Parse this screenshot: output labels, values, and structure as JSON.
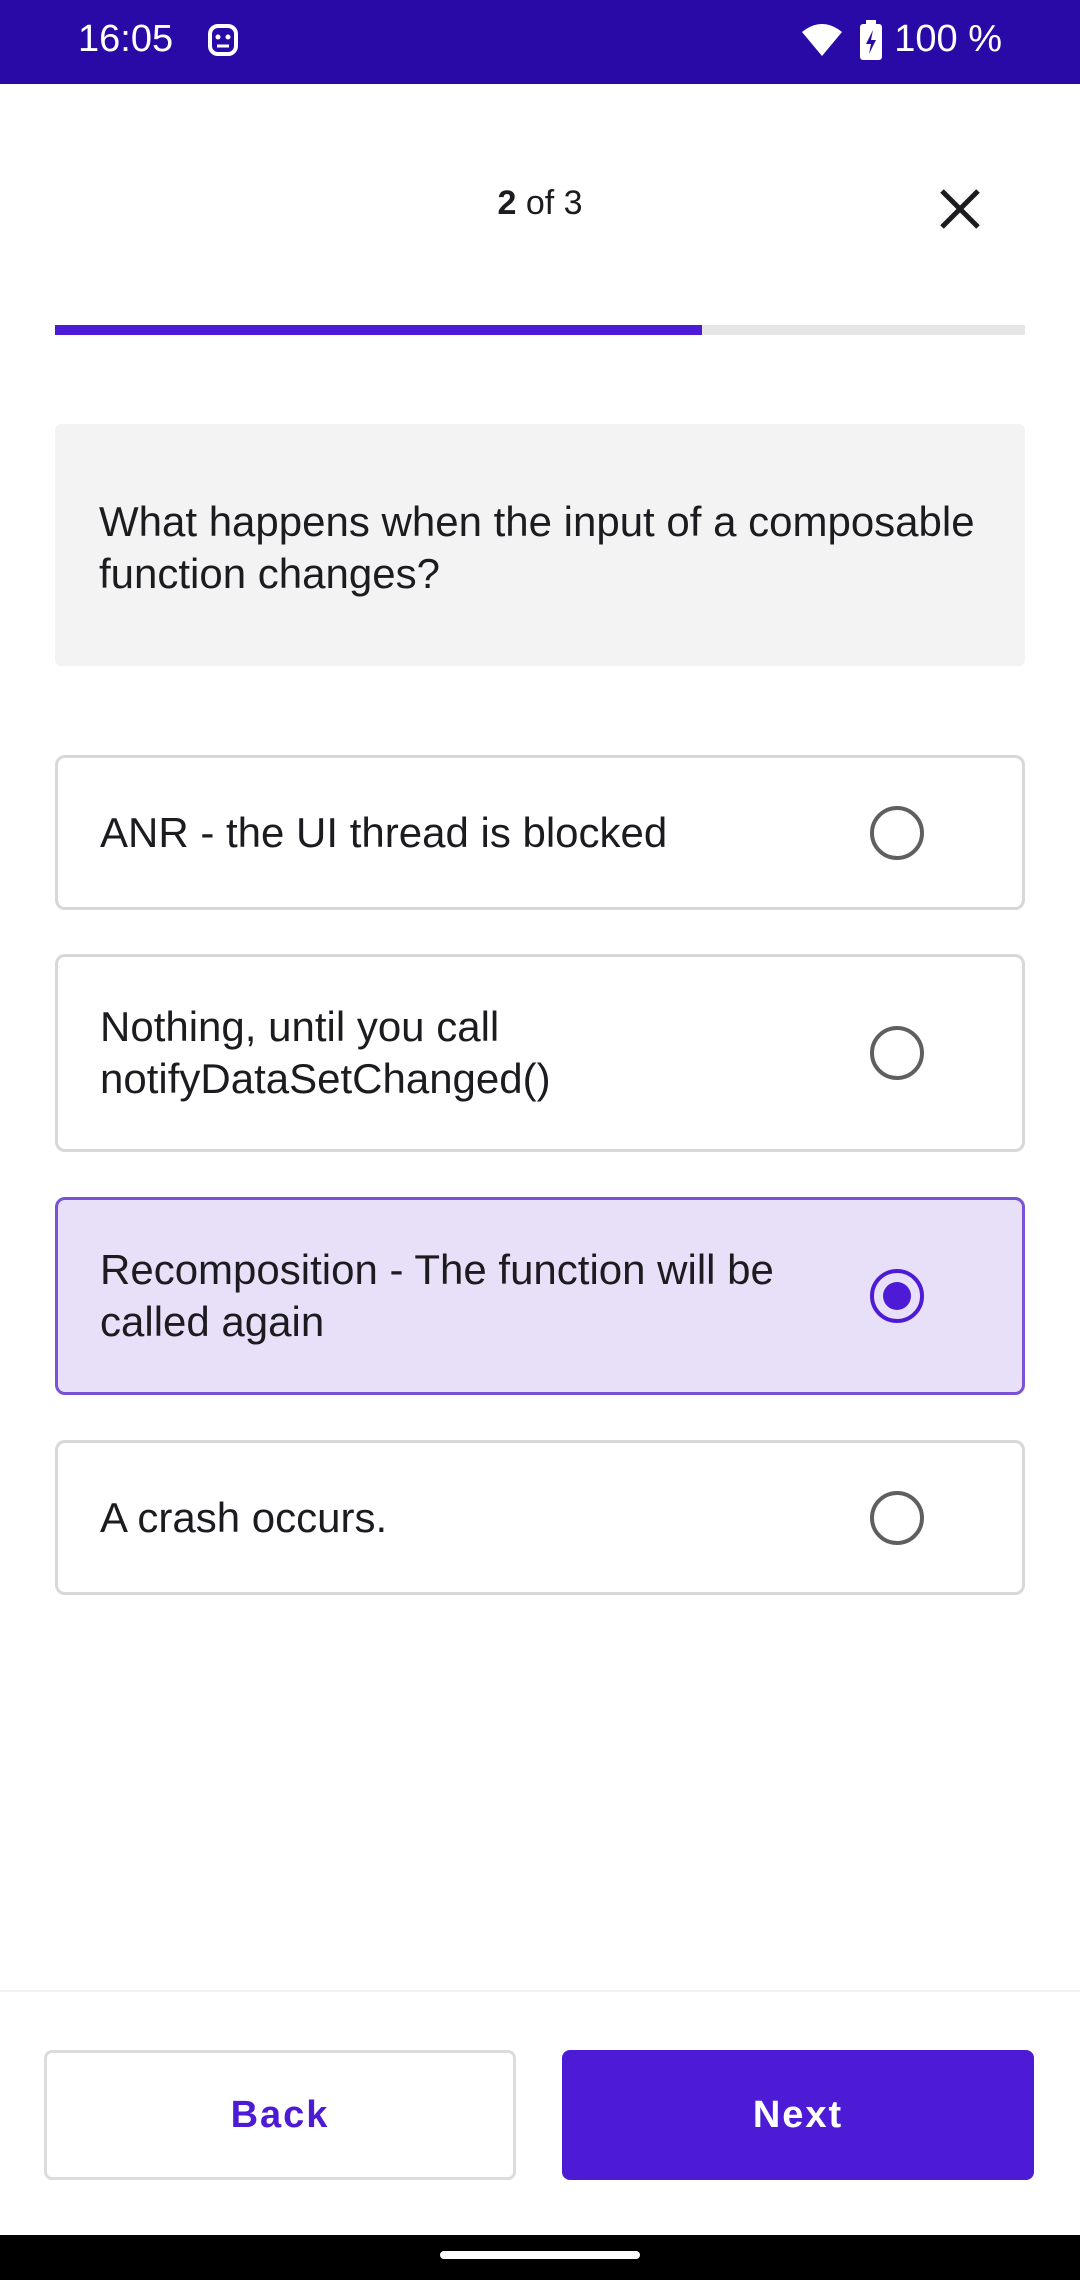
{
  "status_bar": {
    "time": "16:05",
    "battery_text": "100 %",
    "icons": [
      "robot-icon",
      "wifi-icon",
      "battery-charging-icon"
    ]
  },
  "quiz": {
    "step_current": "2",
    "step_of": "of 3",
    "progress": 0.667,
    "question": "What happens when the input of a composable function changes?",
    "options": [
      {
        "label": "ANR - the UI thread is blocked",
        "selected": false
      },
      {
        "label": "Nothing, until you call notifyDataSetChanged()",
        "selected": false
      },
      {
        "label": "Recomposition - The function will be called again",
        "selected": true
      },
      {
        "label": "A crash occurs.",
        "selected": false
      }
    ]
  },
  "buttons": {
    "back": "Back",
    "next": "Next"
  },
  "colors": {
    "accent": "#4d1bd6",
    "status_bar": "#2a0aa6",
    "selected_bg": "#e8e0f8"
  }
}
